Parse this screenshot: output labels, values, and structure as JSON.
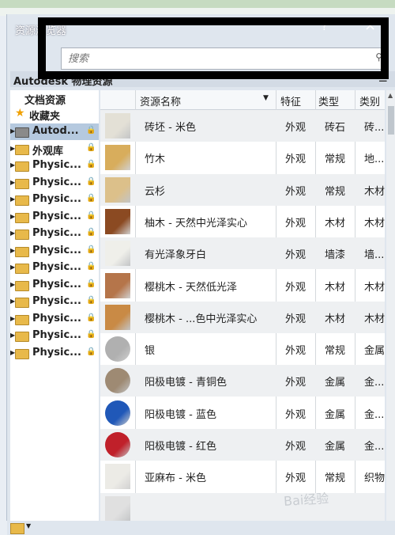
{
  "window": {
    "title": "资源浏览器",
    "help": "?",
    "close": "×"
  },
  "search": {
    "placeholder": "搜索"
  },
  "library": {
    "title": "Autodesk 物理资源",
    "view_icon": "list-view-icon"
  },
  "sidebar": {
    "header": "文档资源",
    "favorites": "收藏夹",
    "items": [
      {
        "label": "Autod...",
        "selected": true
      },
      {
        "label": "外观库"
      },
      {
        "label": "Physic..."
      },
      {
        "label": "Physic..."
      },
      {
        "label": "Physic..."
      },
      {
        "label": "Physic..."
      },
      {
        "label": "Physic..."
      },
      {
        "label": "Physic..."
      },
      {
        "label": "Physic..."
      },
      {
        "label": "Physic..."
      },
      {
        "label": "Physic..."
      },
      {
        "label": "Physic..."
      },
      {
        "label": "Physic..."
      },
      {
        "label": "Physic..."
      }
    ]
  },
  "table": {
    "columns": [
      "资源名称",
      "特征",
      "类型",
      "类别"
    ],
    "rows": [
      {
        "name": "砖坯 - 米色",
        "feature": "外观",
        "type": "砖石",
        "category": "砖...",
        "color": "#e3e0d6"
      },
      {
        "name": "竹木",
        "feature": "外观",
        "type": "常规",
        "category": "地...",
        "color": "#d8ad5c"
      },
      {
        "name": "云杉",
        "feature": "外观",
        "type": "常规",
        "category": "木材",
        "color": "#dcc08a"
      },
      {
        "name": "柚木 - 天然中光泽实心",
        "feature": "外观",
        "type": "木材",
        "category": "木材",
        "color": "#8b4a22"
      },
      {
        "name": "有光泽象牙白",
        "feature": "外观",
        "type": "墙漆",
        "category": "墙...",
        "color": "#efefea"
      },
      {
        "name": "樱桃木 - 天然低光泽",
        "feature": "外观",
        "type": "木材",
        "category": "木材",
        "color": "#b5754a"
      },
      {
        "name": "樱桃木 - ...色中光泽实心",
        "feature": "外观",
        "type": "木材",
        "category": "木材",
        "color": "#c98a45"
      },
      {
        "name": "银",
        "feature": "外观",
        "type": "常规",
        "category": "金属",
        "color": "#b0b0b0"
      },
      {
        "name": "阳极电镀 - 青铜色",
        "feature": "外观",
        "type": "金属",
        "category": "金...",
        "color": "#9e8a73"
      },
      {
        "name": "阳极电镀 - 蓝色",
        "feature": "外观",
        "type": "金属",
        "category": "金...",
        "color": "#2058b8"
      },
      {
        "name": "阳极电镀 - 红色",
        "feature": "外观",
        "type": "金属",
        "category": "金...",
        "color": "#c0202a"
      },
      {
        "name": "亚麻布 - 米色",
        "feature": "外观",
        "type": "常规",
        "category": "织物",
        "color": "#ecebe6"
      },
      {
        "name": "",
        "feature": "",
        "type": "",
        "category": "",
        "color": "#e0e0e0"
      }
    ]
  },
  "watermark": "Bai经验"
}
